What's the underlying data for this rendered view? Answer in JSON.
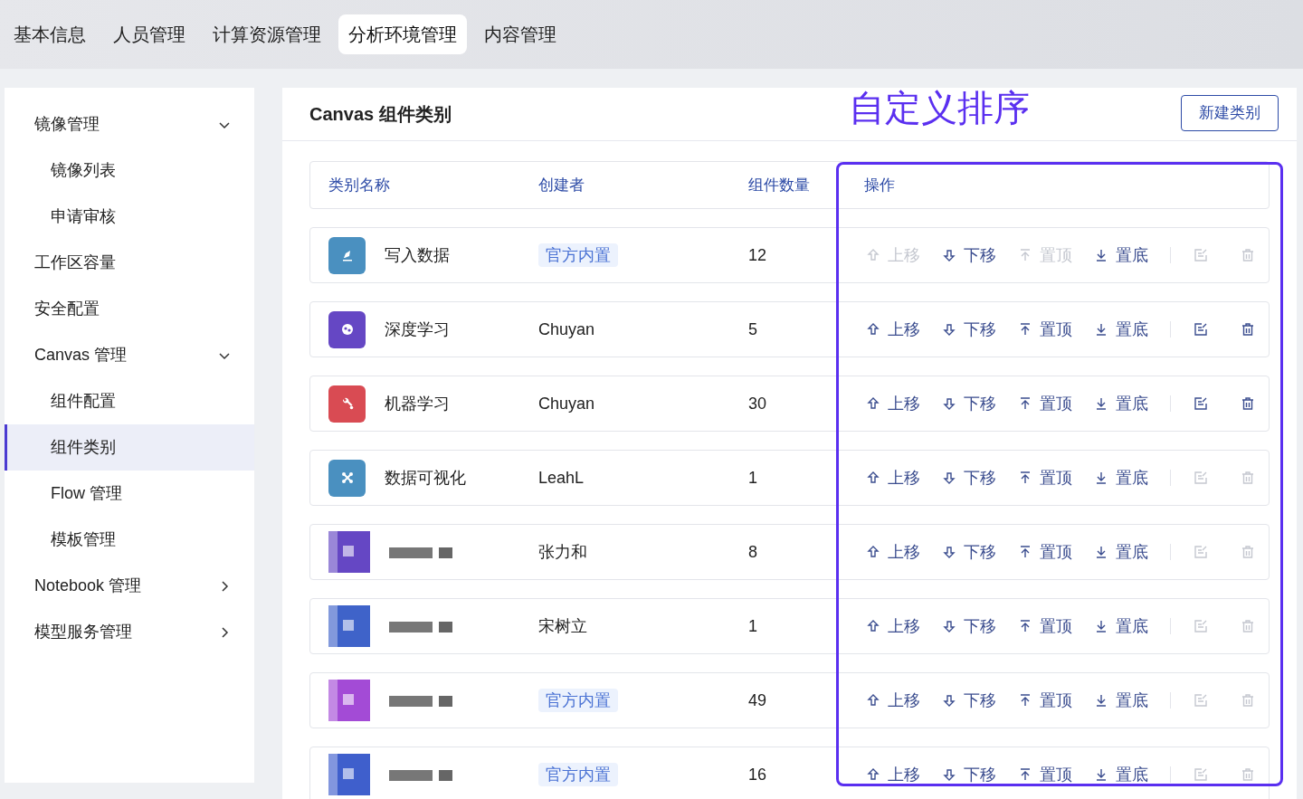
{
  "top_tabs": [
    {
      "label": "基本信息",
      "selected": false
    },
    {
      "label": "人员管理",
      "selected": false
    },
    {
      "label": "计算资源管理",
      "selected": false
    },
    {
      "label": "分析环境管理",
      "selected": true
    },
    {
      "label": "内容管理",
      "selected": false
    }
  ],
  "sidebar": {
    "items": [
      {
        "label": "镜像管理",
        "expanded": true,
        "children": [
          {
            "label": "镜像列表",
            "selected": false
          },
          {
            "label": "申请审核",
            "selected": false
          }
        ]
      },
      {
        "label": "工作区容量",
        "selected": false
      },
      {
        "label": "安全配置",
        "selected": false
      },
      {
        "label": "Canvas 管理",
        "expanded": true,
        "children": [
          {
            "label": "组件配置",
            "selected": false
          },
          {
            "label": "组件类别",
            "selected": true
          },
          {
            "label": "Flow 管理",
            "selected": false
          },
          {
            "label": "模板管理",
            "selected": false
          }
        ]
      },
      {
        "label": "Notebook 管理",
        "expanded": false
      },
      {
        "label": "模型服务管理",
        "expanded": false
      }
    ]
  },
  "panel": {
    "title": "Canvas 组件类别",
    "new_button": "新建类别",
    "annotation": "自定义排序",
    "columns": [
      "类别名称",
      "创建者",
      "组件数量",
      "操作"
    ],
    "rows": [
      {
        "kind": "pen",
        "color": "#4a90c0",
        "name": "写入数据",
        "creator": "官方内置",
        "badge": true,
        "count": "12",
        "actions": [
          {
            "kind": "up",
            "label": "上移",
            "disabled": true
          },
          {
            "kind": "down",
            "label": "下移",
            "disabled": false
          },
          {
            "kind": "top",
            "label": "置顶",
            "disabled": true
          },
          {
            "kind": "bottom",
            "label": "置底",
            "disabled": false
          }
        ],
        "edit_disabled": true,
        "delete_disabled": true
      },
      {
        "kind": "brain",
        "color": "#6547c4",
        "name": "深度学习",
        "creator": "Chuyan",
        "badge": false,
        "count": "5",
        "actions": [
          {
            "kind": "up",
            "label": "上移",
            "disabled": false
          },
          {
            "kind": "down",
            "label": "下移",
            "disabled": false
          },
          {
            "kind": "top",
            "label": "置顶",
            "disabled": false
          },
          {
            "kind": "bottom",
            "label": "置底",
            "disabled": false
          }
        ],
        "edit_disabled": false,
        "delete_disabled": false
      },
      {
        "kind": "wrench",
        "color": "#d94b53",
        "name": "机器学习",
        "creator": "Chuyan",
        "badge": false,
        "count": "30",
        "actions": [
          {
            "kind": "up",
            "label": "上移",
            "disabled": false
          },
          {
            "kind": "down",
            "label": "下移",
            "disabled": false
          },
          {
            "kind": "top",
            "label": "置顶",
            "disabled": false
          },
          {
            "kind": "bottom",
            "label": "置底",
            "disabled": false
          }
        ],
        "edit_disabled": false,
        "delete_disabled": false
      },
      {
        "kind": "nodes",
        "color": "#4a90c0",
        "name": "数据可视化",
        "creator": "LeahL",
        "badge": false,
        "count": "1",
        "actions": [
          {
            "kind": "up",
            "label": "上移",
            "disabled": false
          },
          {
            "kind": "down",
            "label": "下移",
            "disabled": false
          },
          {
            "kind": "top",
            "label": "置顶",
            "disabled": false
          },
          {
            "kind": "bottom",
            "label": "置底",
            "disabled": false
          }
        ],
        "edit_disabled": true,
        "delete_disabled": true
      },
      {
        "kind": "blurred",
        "color": "#6547c4",
        "creator": "张力和",
        "badge": false,
        "count": "8",
        "actions": [
          {
            "kind": "up",
            "label": "上移",
            "disabled": false
          },
          {
            "kind": "down",
            "label": "下移",
            "disabled": false
          },
          {
            "kind": "top",
            "label": "置顶",
            "disabled": false
          },
          {
            "kind": "bottom",
            "label": "置底",
            "disabled": false
          }
        ],
        "edit_disabled": true,
        "delete_disabled": true
      },
      {
        "kind": "blurred",
        "color": "#3f63c9",
        "creator": "宋树立",
        "badge": false,
        "count": "1",
        "actions": [
          {
            "kind": "up",
            "label": "上移",
            "disabled": false
          },
          {
            "kind": "down",
            "label": "下移",
            "disabled": false
          },
          {
            "kind": "top",
            "label": "置顶",
            "disabled": false
          },
          {
            "kind": "bottom",
            "label": "置底",
            "disabled": false
          }
        ],
        "edit_disabled": true,
        "delete_disabled": true
      },
      {
        "kind": "blurred",
        "color": "#a34bd6",
        "creator": "官方内置",
        "badge": true,
        "count": "49",
        "actions": [
          {
            "kind": "up",
            "label": "上移",
            "disabled": false
          },
          {
            "kind": "down",
            "label": "下移",
            "disabled": false
          },
          {
            "kind": "top",
            "label": "置顶",
            "disabled": false
          },
          {
            "kind": "bottom",
            "label": "置底",
            "disabled": false
          }
        ],
        "edit_disabled": true,
        "delete_disabled": true
      },
      {
        "kind": "blurred",
        "color": "#3f5fcc",
        "creator": "官方内置",
        "badge": true,
        "count": "16",
        "actions": [
          {
            "kind": "up",
            "label": "上移",
            "disabled": false
          },
          {
            "kind": "down",
            "label": "下移",
            "disabled": false
          },
          {
            "kind": "top",
            "label": "置顶",
            "disabled": false
          },
          {
            "kind": "bottom",
            "label": "置底",
            "disabled": false
          }
        ],
        "edit_disabled": true,
        "delete_disabled": true
      }
    ]
  }
}
